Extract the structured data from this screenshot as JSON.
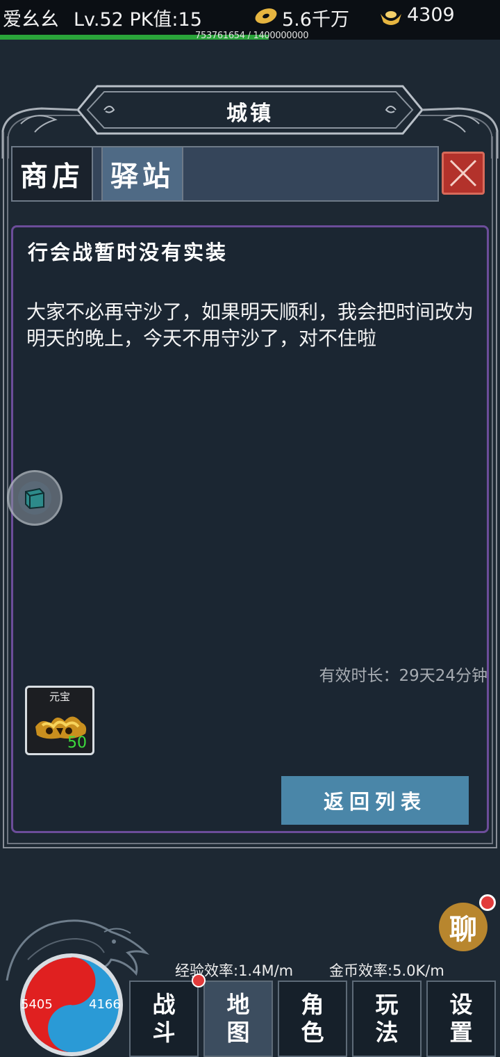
{
  "status": {
    "player_name": "爱幺幺",
    "level_pk": "Lv.52 PK值:15",
    "gold": "5.6千万",
    "ingot": "4309",
    "exp_text": "753761654 / 1400000000",
    "exp_progress": 0.538
  },
  "panel": {
    "title": "城镇",
    "tabs": [
      "商店",
      "驿站"
    ],
    "active_tab": "驿站"
  },
  "message": {
    "title": "行会战暂时没有实装",
    "body": "大家不必再守沙了，如果明天顺利，我会把时间改为明天的晚上，今天不用守沙了，对不住啦",
    "duration": "有效时长：29天24分钟",
    "reward": {
      "name": "元宝",
      "count": "50"
    },
    "back_label": "返回列表"
  },
  "bottom": {
    "chat_label": "聊",
    "exp_rate": "经验效率:1.4M/m",
    "gold_rate": "金币效率:5.0K/m",
    "hp": "5405",
    "mp": "4166",
    "nav": [
      {
        "top": "战",
        "bottom": "斗"
      },
      {
        "top": "地",
        "bottom": "图"
      },
      {
        "top": "角",
        "bottom": "色"
      },
      {
        "top": "玩",
        "bottom": "法"
      },
      {
        "top": "设",
        "bottom": "置"
      }
    ],
    "active_nav": 1
  },
  "colors": {
    "background": "#1d2833",
    "accent_purple": "#6c4d9a",
    "button_blue": "#4a86a8",
    "close_red": "#b3322b",
    "exp_green": "#2aa43a"
  }
}
